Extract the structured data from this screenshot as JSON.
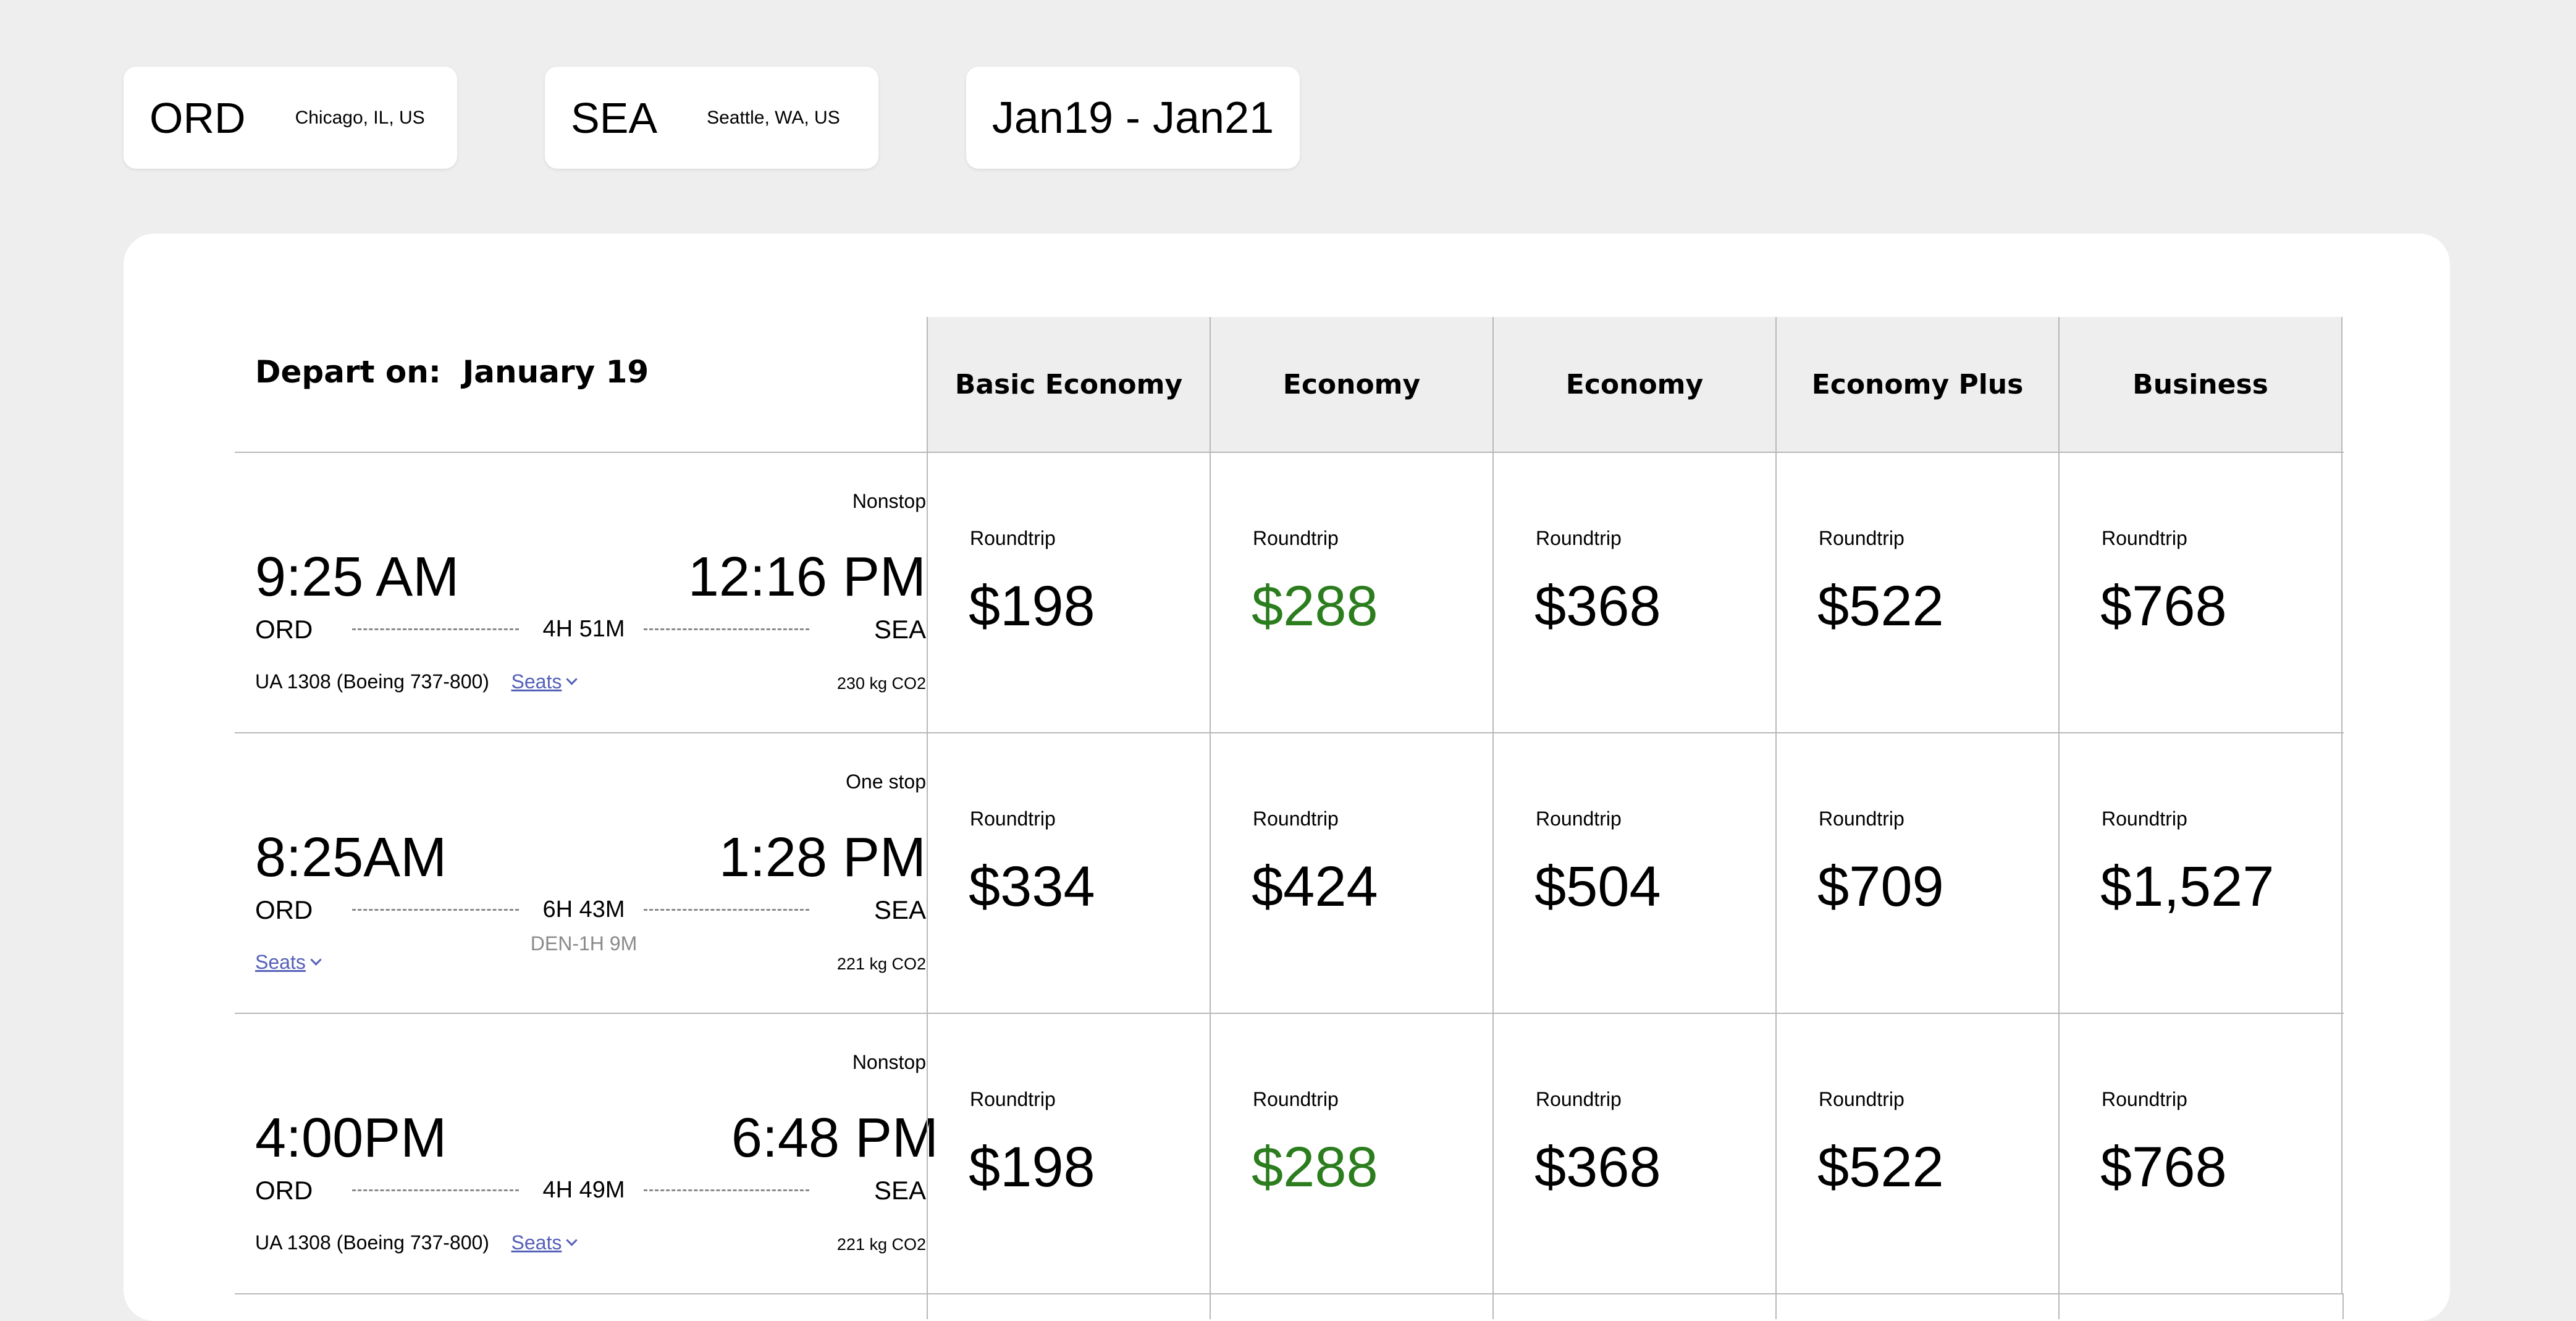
{
  "search": {
    "origin": {
      "code": "ORD",
      "city": "Chicago, IL, US"
    },
    "destination": {
      "code": "SEA",
      "city": "Seattle, WA, US"
    },
    "dates": "Jan19 - Jan21"
  },
  "table": {
    "depart_prefix": "Depart on:",
    "depart_date": "January 19",
    "fare_columns": [
      "Basic Economy",
      "Economy",
      "Economy",
      "Economy Plus",
      "Business"
    ],
    "flights": [
      {
        "stops": "Nonstop",
        "depart_time": "9:25 AM",
        "arrive_time": "12:16 PM",
        "from": "ORD",
        "to": "SEA",
        "duration": "4H 51M",
        "layover": "",
        "flight": "UA 1308 (Boeing 737-800)",
        "seats_label": "Seats",
        "co2": "230 kg CO2",
        "fares": [
          {
            "label": "Roundtrip",
            "price": "$198",
            "highlight": false
          },
          {
            "label": "Roundtrip",
            "price": "$288",
            "highlight": true
          },
          {
            "label": "Roundtrip",
            "price": "$368",
            "highlight": false
          },
          {
            "label": "Roundtrip",
            "price": "$522",
            "highlight": false
          },
          {
            "label": "Roundtrip",
            "price": "$768",
            "highlight": false
          }
        ]
      },
      {
        "stops": "One stop",
        "depart_time": "8:25AM",
        "arrive_time": "1:28 PM",
        "from": "ORD",
        "to": "SEA",
        "duration": "6H 43M",
        "layover": "DEN-1H 9M",
        "flight": "",
        "seats_label": "Seats",
        "co2": "221 kg CO2",
        "fares": [
          {
            "label": "Roundtrip",
            "price": "$334",
            "highlight": false
          },
          {
            "label": "Roundtrip",
            "price": "$424",
            "highlight": false
          },
          {
            "label": "Roundtrip",
            "price": "$504",
            "highlight": false
          },
          {
            "label": "Roundtrip",
            "price": "$709",
            "highlight": false
          },
          {
            "label": "Roundtrip",
            "price": "$1,527",
            "highlight": false
          }
        ]
      },
      {
        "stops": "Nonstop",
        "depart_time": "4:00PM",
        "arrive_time": "6:48 PM",
        "from": "ORD",
        "to": "SEA",
        "duration": "4H 49M",
        "layover": "",
        "flight": "UA 1308 (Boeing 737-800)",
        "seats_label": "Seats",
        "co2": "221 kg CO2",
        "fares": [
          {
            "label": "Roundtrip",
            "price": "$198",
            "highlight": false
          },
          {
            "label": "Roundtrip",
            "price": "$288",
            "highlight": true
          },
          {
            "label": "Roundtrip",
            "price": "$368",
            "highlight": false
          },
          {
            "label": "Roundtrip",
            "price": "$522",
            "highlight": false
          },
          {
            "label": "Roundtrip",
            "price": "$768",
            "highlight": false
          }
        ]
      }
    ]
  },
  "colors": {
    "background": "#eeeeee",
    "highlight_price": "#2b7d1e",
    "link": "#5560b8"
  }
}
